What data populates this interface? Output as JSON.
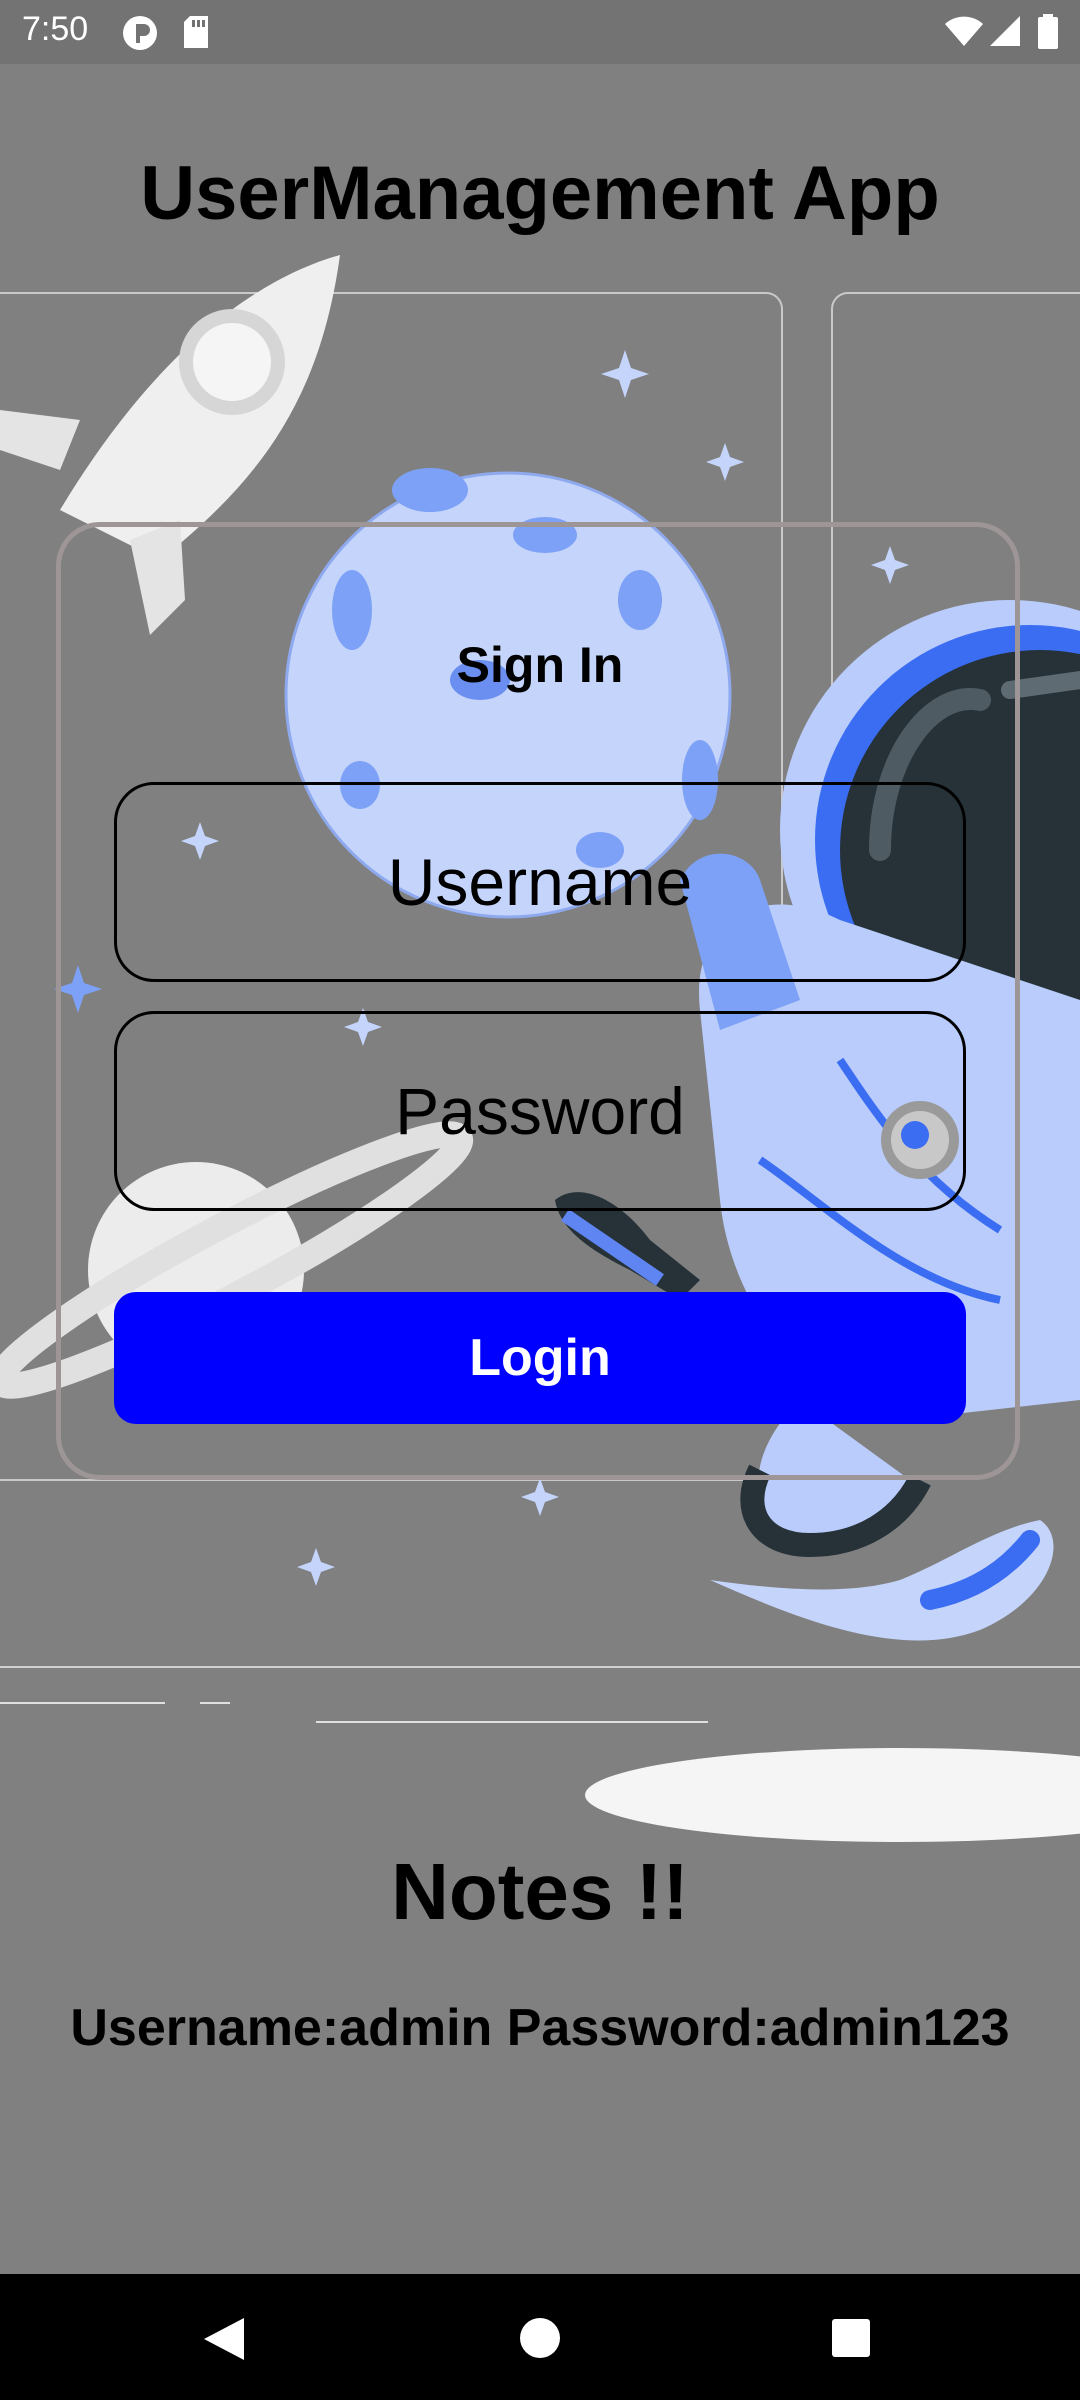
{
  "status_bar": {
    "time": "7:50",
    "left_icons": [
      "p-badge-icon",
      "sd-card-icon"
    ],
    "right_icons": [
      "wifi-icon",
      "signal-icon",
      "battery-icon"
    ]
  },
  "app": {
    "title": "UserManagement App"
  },
  "signin": {
    "heading": "Sign In",
    "username_placeholder": "Username",
    "password_placeholder": "Password",
    "login_label": "Login"
  },
  "notes": {
    "title": "Notes !!",
    "text": "Username:admin Password:admin123"
  },
  "nav_bar": {
    "icons": [
      "back-icon",
      "home-icon",
      "recents-icon"
    ]
  },
  "colors": {
    "background": "#808080",
    "login_button": "#0000ff",
    "card_border": "#9e9696",
    "illustration_blue": "#7ca1f7"
  }
}
